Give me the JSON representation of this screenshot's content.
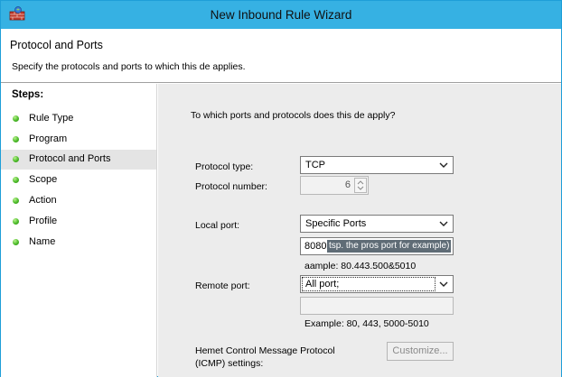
{
  "window": {
    "title": "New Inbound Rule Wizard"
  },
  "header": {
    "title": "Protocol and Ports",
    "subtitle": "Specify the protocols and ports to which this de applies."
  },
  "steps": {
    "title": "Steps:",
    "items": [
      {
        "label": "Rule Type"
      },
      {
        "label": "Program"
      },
      {
        "label": "Protocol and Ports"
      },
      {
        "label": "Scope"
      },
      {
        "label": "Action"
      },
      {
        "label": "Profile"
      },
      {
        "label": "Name"
      }
    ],
    "active_index": 2
  },
  "main": {
    "question": "To which ports and protocols does this de apply?",
    "protocol_type": {
      "label": "Protocol type:",
      "value": "TCP"
    },
    "protocol_number": {
      "label": "Protocol number:",
      "value": "6"
    },
    "local_port": {
      "label": "Local port:",
      "value": "Specific Ports",
      "input_value": "8080",
      "input_selection": "tsp. the pros port for example)",
      "example": "aample: 80.443.500&5010"
    },
    "remote_port": {
      "label": "Remote port:",
      "value": "All port;",
      "input_value": "",
      "example": "Example: 80, 443, 5000-5010"
    },
    "icmp": {
      "label_line1": "Hemet Control Message Protocol",
      "label_line2": "(ICMP) settings:",
      "button": "Customize..."
    }
  },
  "colors": {
    "titlebar": "#36b1e3",
    "window_border": "#1e9ed8",
    "content_bg": "#ececec",
    "active_step_bg": "#e4e4e4",
    "step_bullet": "#4dbb2a",
    "selection_bg": "#5f6c76"
  }
}
